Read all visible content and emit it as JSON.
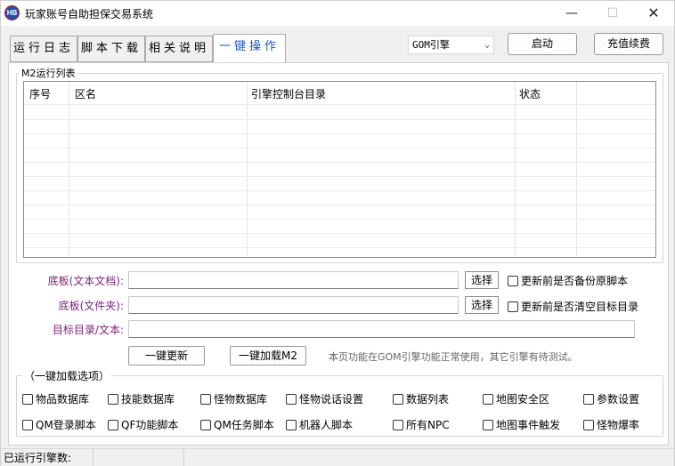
{
  "window": {
    "title": "玩家账号自助担保交易系统",
    "icon_text": "HB",
    "minimize": "—",
    "maximize": "☐",
    "close": "✕"
  },
  "tabs": [
    {
      "label": "运行日志"
    },
    {
      "label": "脚本下载"
    },
    {
      "label": "相关说明"
    },
    {
      "label": "一键操作"
    }
  ],
  "engine_select": {
    "value": "GOM引擎"
  },
  "buttons": {
    "start": "启动",
    "recharge": "充值续费"
  },
  "m2_group": {
    "title": "M2运行列表",
    "columns": [
      "序号",
      "区名",
      "引擎控制台目录",
      "状态"
    ]
  },
  "form": {
    "base_doc_label": "底板(文本文档):",
    "base_folder_label": "底板(文件夹):",
    "target_label": "目标目录/文本:",
    "select1": "选择",
    "select2": "选择",
    "backup_option": "更新前是否备份原脚本",
    "clear_option": "更新前是否清空目标目录",
    "update_all": "一键更新",
    "load_m2": "一键加载M2",
    "note": "本页功能在GOM引擎功能正常使用，其它引擎有待测试。"
  },
  "load_group": {
    "title": "（一键加载选项）",
    "row1": [
      "物品数据库",
      "技能数据库",
      "怪物数据库",
      "怪物说话设置",
      "数据列表",
      "地图安全区",
      "参数设置"
    ],
    "row2": [
      "QM登录脚本",
      "QF功能脚本",
      "QM任务脚本",
      "机器人脚本",
      "所有NPC",
      "地图事件触发",
      "怪物爆率"
    ]
  },
  "statusbar": {
    "engines_running": "已运行引擎数:"
  }
}
